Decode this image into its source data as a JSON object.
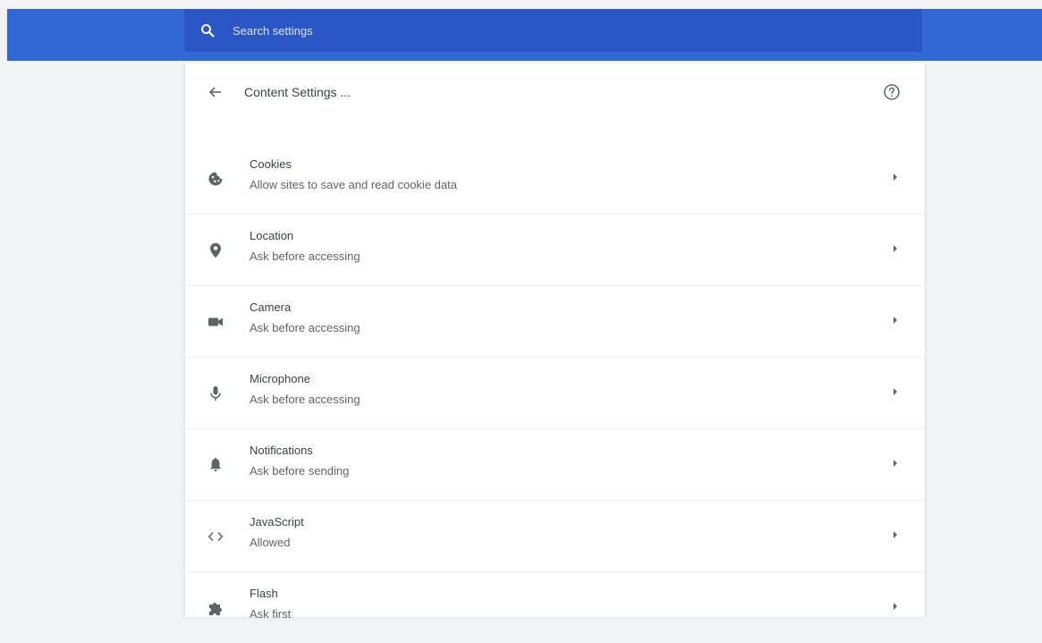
{
  "search": {
    "placeholder": "Search settings"
  },
  "header": {
    "title": "Content Settings ..."
  },
  "icons": {
    "search": "search-icon",
    "back": "arrow-back-icon",
    "help": "help-circle-icon",
    "row_arrow": "arrow-right-icon"
  },
  "colors": {
    "topbar": "#3367d6",
    "searchbar": "#2a56c6",
    "icon": "#5f6368",
    "background": "#f1f3f4"
  },
  "settings": [
    {
      "title": "Cookies",
      "subtitle": "Allow sites to save and read cookie data",
      "icon": "cookie-icon"
    },
    {
      "title": "Location",
      "subtitle": "Ask before accessing",
      "icon": "location-pin-icon"
    },
    {
      "title": "Camera",
      "subtitle": "Ask before accessing",
      "icon": "camera-icon"
    },
    {
      "title": "Microphone",
      "subtitle": "Ask before accessing",
      "icon": "microphone-icon"
    },
    {
      "title": "Notifications",
      "subtitle": "Ask before sending",
      "icon": "bell-icon"
    },
    {
      "title": "JavaScript",
      "subtitle": "Allowed",
      "icon": "code-icon"
    },
    {
      "title": "Flash",
      "subtitle": "Ask first",
      "icon": "puzzle-icon"
    }
  ]
}
